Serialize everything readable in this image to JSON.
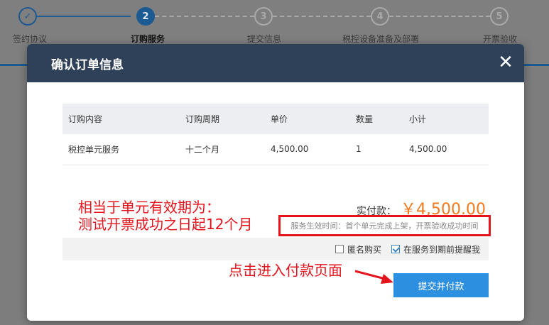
{
  "stepper": {
    "steps": [
      {
        "num": "",
        "label": "签约协议",
        "state": "done"
      },
      {
        "num": "2",
        "label": "订购服务",
        "state": "active"
      },
      {
        "num": "3",
        "label": "提交信息",
        "state": "todo"
      },
      {
        "num": "4",
        "label": "税控设备准备及部署",
        "state": "todo"
      },
      {
        "num": "5",
        "label": "开票验收",
        "state": "todo"
      }
    ]
  },
  "modal": {
    "title": "确认订单信息",
    "close_label": "✕",
    "table": {
      "headers": [
        "订购内容",
        "订购周期",
        "单价",
        "数量",
        "小计"
      ],
      "rows": [
        [
          "税控单元服务",
          "十二个月",
          "4,500.00",
          "1",
          "4,500.00"
        ]
      ]
    },
    "total_label": "实付款：",
    "total_value": "￥4,500.00",
    "effective_note": "服务生效时间：首个单元完成上架，开票验收成功时间",
    "options": {
      "anonymous_label": "匿名购买",
      "anonymous_checked": false,
      "remind_label": "在服务到期前提醒我",
      "remind_checked": true
    },
    "submit_label": "提交并付款"
  },
  "annotations": {
    "note_line1": "相当于单元有效期为：",
    "note_line2": "测试开票成功之日起12个月",
    "pay_hint": "点击进入付款页面"
  },
  "colors": {
    "header_bg": "#2f4158",
    "accent_blue": "#2d8fe0",
    "price_orange": "#f07a1d",
    "annotation_red": "#e5131b"
  }
}
